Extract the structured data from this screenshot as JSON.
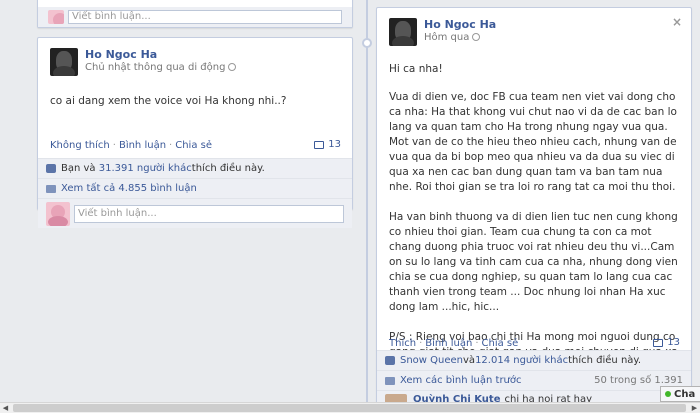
{
  "top_card": {
    "comment_placeholder": "Viết bình luận..."
  },
  "left_post": {
    "author": "Ho Ngoc Ha",
    "meta": "Chủ nhật thông qua di động",
    "text": "co ai dang xem the voice voi Ha khong nhi..?",
    "actions": {
      "unlike": "Không thích",
      "comment": "Bình luận",
      "share": "Chia sẻ"
    },
    "comment_count": "13",
    "likes": {
      "prefix": "Bạn và ",
      "count_link": "31.391 người khác",
      "suffix": " thích điều này."
    },
    "view_all": "Xem tất cả 4.855 bình luận",
    "comment_placeholder": "Viết bình luận..."
  },
  "right_post": {
    "author": "Ho Ngoc Ha",
    "meta": "Hôm qua",
    "close": "×",
    "paragraphs": [
      "Hi ca nha!",
      "Vua di dien ve, doc FB cua team nen viet vai dong cho ca nha: Ha that khong vui chut nao vi da de cac ban lo lang va quan tam cho Ha trong nhung ngay vua qua. Mot van de co the hieu theo nhieu cach, nhung van de vua qua da bi bop meo qua nhieu va da dua su viec di qua xa nen cac ban dung quan tam va ban tam nua nhe. Roi thoi gian se tra loi ro rang tat ca moi thu thoi.",
      "Ha van binh thuong va di dien lien tuc nen cung khong co nhieu thoi gian. Team cua chung ta con ca mot chang duong phia truoc voi rat nhieu deu thu vi...Cam on su lo lang va tinh cam cua ca nha, nhung dong vien chia se cua dong nghiep, su quan tam lo lang cua cac thanh vien trong team ... Doc nhung loi nhan Ha xuc dong lam ...hic, hic...",
      "P/S : Rieng voi bao chi thi Ha mong moi nguoi dung co gang giat tit cho giat gan va dua moi chuyen di qua xa nua. Thanks moi nguoi..."
    ],
    "actions": {
      "like": "Thích",
      "comment": "Bình luận",
      "share": "Chia sẻ"
    },
    "comment_count": "13",
    "likes": {
      "name_link": "Snow Queen",
      "mid": " và ",
      "count_link": "12.014 người khác",
      "suffix": " thích điều này."
    },
    "view_prev": "Xem các bình luận trước",
    "pager": "50 trong số 1.391",
    "comment": {
      "name": "Quỳnh Chi Kute",
      "text": "chị ha noi rat hay"
    }
  },
  "chat": {
    "label": "Cha"
  }
}
